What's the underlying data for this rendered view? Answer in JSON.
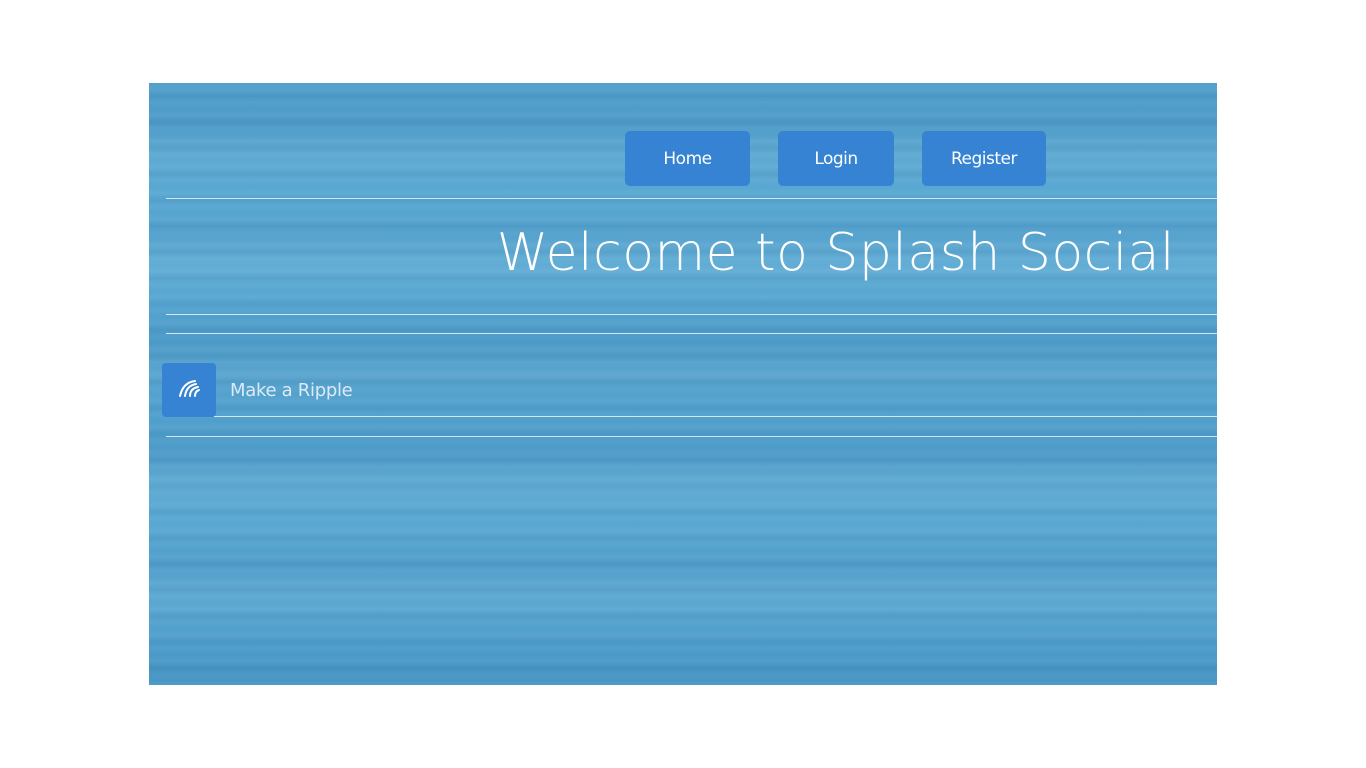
{
  "nav": {
    "items": [
      {
        "label": "Home"
      },
      {
        "label": "Login"
      },
      {
        "label": "Register"
      }
    ]
  },
  "header": {
    "title": "Welcome to Splash Social"
  },
  "ripple": {
    "icon": "wave-icon",
    "label": "Make a Ripple"
  },
  "colors": {
    "background": "#5aaad4",
    "button": "#3583d2",
    "text": "#ffffff"
  }
}
